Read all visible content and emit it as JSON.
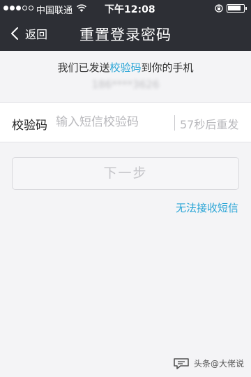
{
  "status_bar": {
    "carrier": "中国联通",
    "time": "下午12:08"
  },
  "nav": {
    "back_label": "返回",
    "title": "重置登录密码"
  },
  "message": {
    "prefix": "我们已发送",
    "link": "校验码",
    "suffix": "到你的手机",
    "phone_masked": "186****3626"
  },
  "code_row": {
    "label": "校验码",
    "placeholder": "输入短信校验码",
    "value": "",
    "resend_countdown": "57秒后重发"
  },
  "next_button": {
    "label": "下一步"
  },
  "no_sms_link": "无法接收短信",
  "watermark": {
    "text": "头条@大佬说"
  },
  "colors": {
    "header_bg": "#2d2f35",
    "accent": "#2aa5d6",
    "page_bg": "#f4f4f6"
  }
}
